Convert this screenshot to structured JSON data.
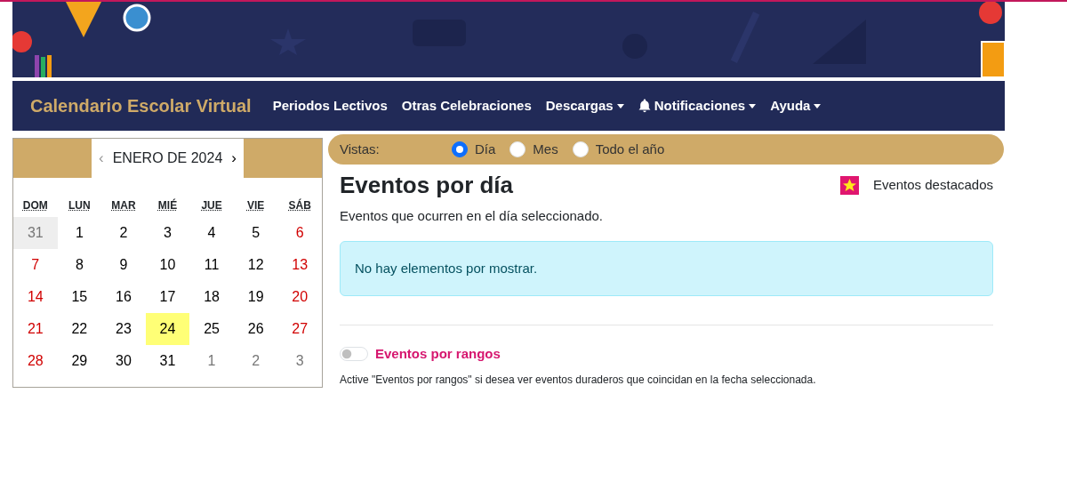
{
  "navbar": {
    "brand": "Calendario Escolar Virtual",
    "items": [
      {
        "label": "Periodos Lectivos",
        "dropdown": false,
        "kind": "plain"
      },
      {
        "label": "Otras Celebraciones",
        "dropdown": false,
        "kind": "plain"
      },
      {
        "label": "Descargas",
        "dropdown": true,
        "kind": "plain"
      },
      {
        "label": "Notificaciones",
        "dropdown": true,
        "kind": "alerts"
      },
      {
        "label": "Ayuda",
        "dropdown": true,
        "kind": "plain"
      }
    ]
  },
  "calendar": {
    "prev": {
      "label": "‹",
      "disabled": true
    },
    "title": "ENERO DE 2024",
    "next": {
      "label": "›",
      "disabled": false
    },
    "weekdays": [
      "DOM",
      "LUN",
      "MAR",
      "MIÉ",
      "JUE",
      "VIE",
      "SÁB"
    ],
    "days": [
      {
        "day": "31",
        "kind": "outside",
        "selected": false,
        "shaded": true
      },
      {
        "day": "1",
        "kind": "weekday",
        "selected": false,
        "shaded": false
      },
      {
        "day": "2",
        "kind": "weekday",
        "selected": false,
        "shaded": false
      },
      {
        "day": "3",
        "kind": "weekday",
        "selected": false,
        "shaded": false
      },
      {
        "day": "4",
        "kind": "weekday",
        "selected": false,
        "shaded": false
      },
      {
        "day": "5",
        "kind": "weekday",
        "selected": false,
        "shaded": false
      },
      {
        "day": "6",
        "kind": "weekend",
        "selected": false,
        "shaded": false
      },
      {
        "day": "7",
        "kind": "weekend",
        "selected": false,
        "shaded": false
      },
      {
        "day": "8",
        "kind": "weekday",
        "selected": false,
        "shaded": false
      },
      {
        "day": "9",
        "kind": "weekday",
        "selected": false,
        "shaded": false
      },
      {
        "day": "10",
        "kind": "weekday",
        "selected": false,
        "shaded": false
      },
      {
        "day": "11",
        "kind": "weekday",
        "selected": false,
        "shaded": false
      },
      {
        "day": "12",
        "kind": "weekday",
        "selected": false,
        "shaded": false
      },
      {
        "day": "13",
        "kind": "weekend",
        "selected": false,
        "shaded": false
      },
      {
        "day": "14",
        "kind": "weekend",
        "selected": false,
        "shaded": false
      },
      {
        "day": "15",
        "kind": "weekday",
        "selected": false,
        "shaded": false
      },
      {
        "day": "16",
        "kind": "weekday",
        "selected": false,
        "shaded": false
      },
      {
        "day": "17",
        "kind": "weekday",
        "selected": false,
        "shaded": false
      },
      {
        "day": "18",
        "kind": "weekday",
        "selected": false,
        "shaded": false
      },
      {
        "day": "19",
        "kind": "weekday",
        "selected": false,
        "shaded": false
      },
      {
        "day": "20",
        "kind": "weekend",
        "selected": false,
        "shaded": false
      },
      {
        "day": "21",
        "kind": "weekend",
        "selected": false,
        "shaded": false
      },
      {
        "day": "22",
        "kind": "weekday",
        "selected": false,
        "shaded": false
      },
      {
        "day": "23",
        "kind": "weekday",
        "selected": false,
        "shaded": false
      },
      {
        "day": "24",
        "kind": "weekday",
        "selected": true,
        "shaded": false
      },
      {
        "day": "25",
        "kind": "weekday",
        "selected": false,
        "shaded": false
      },
      {
        "day": "26",
        "kind": "weekday",
        "selected": false,
        "shaded": false
      },
      {
        "day": "27",
        "kind": "weekend",
        "selected": false,
        "shaded": false
      },
      {
        "day": "28",
        "kind": "weekend",
        "selected": false,
        "shaded": false
      },
      {
        "day": "29",
        "kind": "weekday",
        "selected": false,
        "shaded": false
      },
      {
        "day": "30",
        "kind": "weekday",
        "selected": false,
        "shaded": false
      },
      {
        "day": "31",
        "kind": "weekday",
        "selected": false,
        "shaded": false
      },
      {
        "day": "1",
        "kind": "outside",
        "selected": false,
        "shaded": false
      },
      {
        "day": "2",
        "kind": "outside",
        "selected": false,
        "shaded": false
      },
      {
        "day": "3",
        "kind": "outside",
        "selected": false,
        "shaded": false
      }
    ]
  },
  "views": {
    "label": "Vistas:",
    "options": [
      {
        "label": "Día",
        "selected": true
      },
      {
        "label": "Mes",
        "selected": false
      },
      {
        "label": "Todo el año",
        "selected": false
      }
    ]
  },
  "legend": {
    "label": "Eventos destacados"
  },
  "heading": "Eventos por día",
  "subtitle": "Eventos que ocurren en el día seleccionado.",
  "alert": "No hay elementos por mostrar.",
  "range_toggle": {
    "label": "Eventos por rangos",
    "on": false
  },
  "range_help": "Active \"Eventos por rangos\" si desea ver eventos duraderos que coincidan en la fecha seleccionada."
}
